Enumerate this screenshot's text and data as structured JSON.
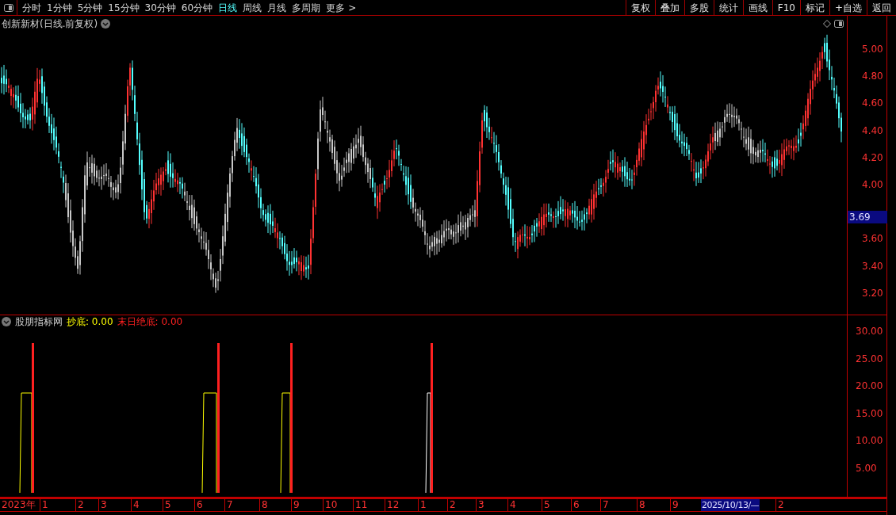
{
  "toolbar": {
    "periods": [
      {
        "label": "分时",
        "selected": false
      },
      {
        "label": "1分钟",
        "selected": false
      },
      {
        "label": "5分钟",
        "selected": false
      },
      {
        "label": "15分钟",
        "selected": false
      },
      {
        "label": "30分钟",
        "selected": false
      },
      {
        "label": "60分钟",
        "selected": false
      },
      {
        "label": "日线",
        "selected": true
      },
      {
        "label": "周线",
        "selected": false
      },
      {
        "label": "月线",
        "selected": false
      },
      {
        "label": "多周期",
        "selected": false
      }
    ],
    "more": "更多",
    "more_arrow": ">",
    "buttons": [
      "复权",
      "叠加",
      "多股",
      "统计",
      "画线",
      "F10",
      "标记",
      "+自选",
      "返回"
    ]
  },
  "main_chart": {
    "title": "创新新材(日线.前复权)",
    "price_ticks": [
      "5.00",
      "4.80",
      "4.60",
      "4.40",
      "4.20",
      "4.00",
      "3.60",
      "3.40",
      "3.20"
    ],
    "current_price": "3.69"
  },
  "indicator": {
    "name": "股朋指标网",
    "values": [
      {
        "label": "抄底: 0.00",
        "color": "#ffff00"
      },
      {
        "label": "末日绝底: 0.00",
        "color": "#ff2020"
      }
    ],
    "ticks": [
      "30.00",
      "25.00",
      "20.00",
      "15.00",
      "10.00",
      "5.00"
    ]
  },
  "time_axis": [
    {
      "label": "2023年",
      "kind": "year"
    },
    {
      "label": "1",
      "kind": "month"
    },
    {
      "label": "2",
      "kind": "month"
    },
    {
      "label": "3",
      "kind": "month"
    },
    {
      "label": "4",
      "kind": "month"
    },
    {
      "label": "5",
      "kind": "month"
    },
    {
      "label": "6",
      "kind": "month"
    },
    {
      "label": "7",
      "kind": "month"
    },
    {
      "label": "8",
      "kind": "month"
    },
    {
      "label": "9",
      "kind": "month"
    },
    {
      "label": "10",
      "kind": "month"
    },
    {
      "label": "11",
      "kind": "month"
    },
    {
      "label": "12",
      "kind": "month"
    },
    {
      "label": "1",
      "kind": "month"
    },
    {
      "label": "2",
      "kind": "month"
    },
    {
      "label": "3",
      "kind": "month"
    },
    {
      "label": "4",
      "kind": "month"
    },
    {
      "label": "5",
      "kind": "month"
    },
    {
      "label": "6",
      "kind": "month"
    },
    {
      "label": "7",
      "kind": "month"
    },
    {
      "label": "8",
      "kind": "month"
    },
    {
      "label": "9",
      "kind": "month"
    },
    {
      "label": "2025/10/13/—",
      "kind": "cursor"
    },
    {
      "label": "2",
      "kind": "month"
    }
  ]
}
